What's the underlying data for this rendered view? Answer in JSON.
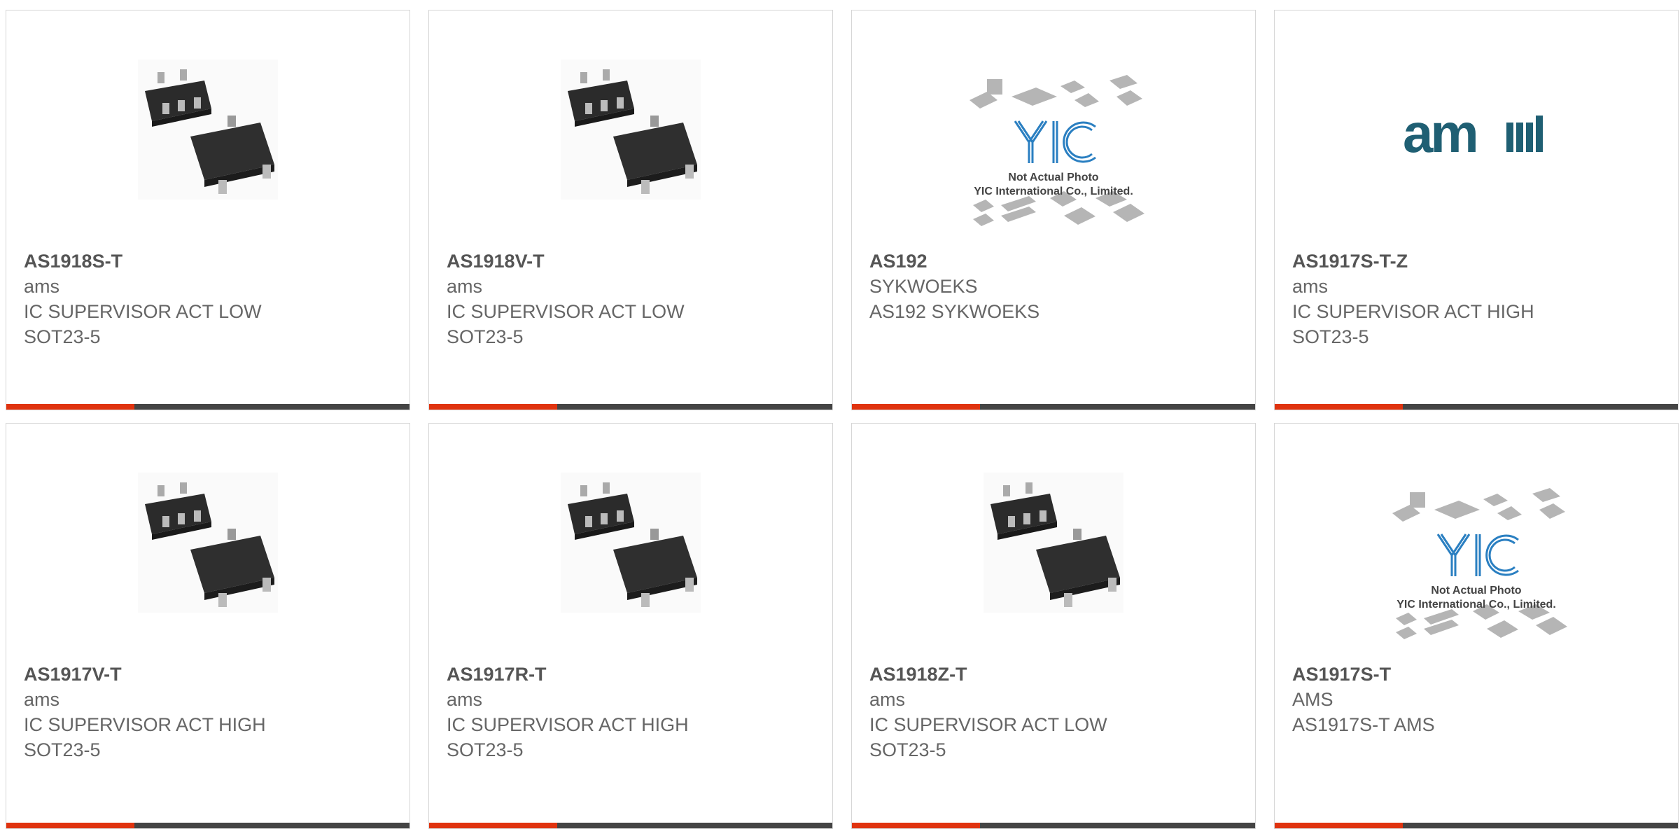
{
  "products": [
    {
      "part": "AS1918S-T",
      "brand": "ams",
      "desc": "IC SUPERVISOR ACT LOW",
      "package": "SOT23-5",
      "image": "sot23-chip"
    },
    {
      "part": "AS1918V-T",
      "brand": "ams",
      "desc": "IC SUPERVISOR ACT LOW",
      "package": "SOT23-5",
      "image": "sot23-chip"
    },
    {
      "part": "AS192",
      "brand": "SYKWOEKS",
      "desc": "AS192 SYKWOEKS",
      "package": "",
      "image": "yic-placeholder",
      "placeholder_text": [
        "Not Actual Photo",
        "YIC International Co., Limited."
      ]
    },
    {
      "part": "AS1917S-T-Z",
      "brand": "ams",
      "desc": "IC SUPERVISOR ACT HIGH",
      "package": "SOT23-5",
      "image": "ams-logo",
      "logo_text": "ams"
    },
    {
      "part": "AS1917V-T",
      "brand": "ams",
      "desc": "IC SUPERVISOR ACT HIGH",
      "package": "SOT23-5",
      "image": "sot23-chip"
    },
    {
      "part": "AS1917R-T",
      "brand": "ams",
      "desc": "IC SUPERVISOR ACT HIGH",
      "package": "SOT23-5",
      "image": "sot23-chip"
    },
    {
      "part": "AS1918Z-T",
      "brand": "ams",
      "desc": "IC SUPERVISOR ACT LOW",
      "package": "SOT23-5",
      "image": "sot23-chip"
    },
    {
      "part": "AS1917S-T",
      "brand": "AMS",
      "desc": "AS1917S-T AMS",
      "package": "",
      "image": "yic-placeholder",
      "placeholder_text": [
        "Not Actual Photo",
        "YIC International Co., Limited."
      ]
    }
  ],
  "colors": {
    "accent": "#e0330f",
    "bar": "#444444",
    "border": "#d6d6d6",
    "yic_blue": "#2a7fc1",
    "ams_teal": "#1f5f73"
  }
}
